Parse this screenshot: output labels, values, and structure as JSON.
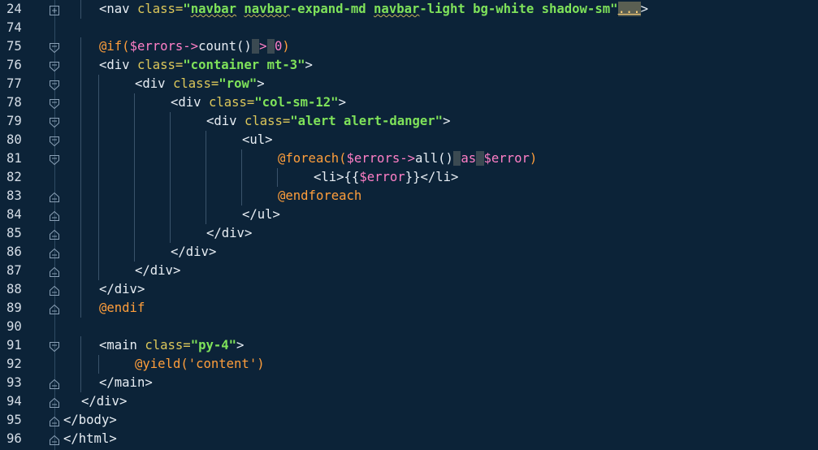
{
  "editor": {
    "theme_background": "#0c2338",
    "lines": [
      {
        "num": "24",
        "fold": "plus",
        "indent": 4,
        "tokens": [
          {
            "t": "<nav ",
            "c": "t-tag"
          },
          {
            "t": "class=",
            "c": "t-attr"
          },
          {
            "t": "\"",
            "c": "t-str"
          },
          {
            "t": "navbar",
            "c": "t-str squiggle"
          },
          {
            "t": " ",
            "c": "t-str"
          },
          {
            "t": "navbar",
            "c": "t-str squiggle"
          },
          {
            "t": "-expand-md ",
            "c": "t-str"
          },
          {
            "t": "navbar",
            "c": "t-str squiggle"
          },
          {
            "t": "-light bg-white shadow-sm\"",
            "c": "t-str"
          },
          {
            "t": "...",
            "c": "ellipsis"
          },
          {
            "t": ">",
            "c": "t-tag"
          }
        ]
      },
      {
        "num": "74",
        "fold": "none",
        "indent": 0,
        "tokens": []
      },
      {
        "num": "75",
        "fold": "open",
        "indent": 4,
        "tokens": [
          {
            "t": "@if(",
            "c": "t-dir"
          },
          {
            "t": "$errors",
            "c": "t-var"
          },
          {
            "t": "->",
            "c": "t-op"
          },
          {
            "t": "count()",
            "c": "t-func"
          },
          {
            "t": " ",
            "c": "hl-space"
          },
          {
            "t": ">",
            "c": "t-op"
          },
          {
            "t": " ",
            "c": "hl-space"
          },
          {
            "t": "0",
            "c": "t-num"
          },
          {
            "t": ")",
            "c": "t-dir"
          }
        ]
      },
      {
        "num": "76",
        "fold": "open",
        "indent": 4,
        "tokens": [
          {
            "t": "<div ",
            "c": "t-tag"
          },
          {
            "t": "class=",
            "c": "t-attr"
          },
          {
            "t": "\"container mt-3\"",
            "c": "t-str"
          },
          {
            "t": ">",
            "c": "t-tag"
          }
        ]
      },
      {
        "num": "77",
        "fold": "open",
        "indent": 8,
        "tokens": [
          {
            "t": "<div ",
            "c": "t-tag"
          },
          {
            "t": "class=",
            "c": "t-attr"
          },
          {
            "t": "\"row\"",
            "c": "t-str"
          },
          {
            "t": ">",
            "c": "t-tag"
          }
        ]
      },
      {
        "num": "78",
        "fold": "open",
        "indent": 12,
        "tokens": [
          {
            "t": "<div ",
            "c": "t-tag"
          },
          {
            "t": "class=",
            "c": "t-attr"
          },
          {
            "t": "\"col-sm-12\"",
            "c": "t-str"
          },
          {
            "t": ">",
            "c": "t-tag"
          }
        ]
      },
      {
        "num": "79",
        "fold": "open",
        "indent": 16,
        "tokens": [
          {
            "t": "<div ",
            "c": "t-tag"
          },
          {
            "t": "class=",
            "c": "t-attr"
          },
          {
            "t": "\"alert alert-danger\"",
            "c": "t-str"
          },
          {
            "t": ">",
            "c": "t-tag"
          }
        ]
      },
      {
        "num": "80",
        "fold": "open",
        "indent": 20,
        "tokens": [
          {
            "t": "<ul>",
            "c": "t-tag"
          }
        ]
      },
      {
        "num": "81",
        "fold": "open",
        "indent": 24,
        "tokens": [
          {
            "t": "@foreach(",
            "c": "t-dir"
          },
          {
            "t": "$errors",
            "c": "t-var"
          },
          {
            "t": "->",
            "c": "t-op"
          },
          {
            "t": "all()",
            "c": "t-func"
          },
          {
            "t": " ",
            "c": "hl-space"
          },
          {
            "t": "as",
            "c": "t-kw"
          },
          {
            "t": " ",
            "c": "hl-space"
          },
          {
            "t": "$error",
            "c": "t-var"
          },
          {
            "t": ")",
            "c": "t-dir"
          }
        ]
      },
      {
        "num": "82",
        "fold": "none",
        "indent": 28,
        "tokens": [
          {
            "t": "<li>{{",
            "c": "t-tag"
          },
          {
            "t": "$error",
            "c": "t-var"
          },
          {
            "t": "}}</li>",
            "c": "t-tag"
          }
        ]
      },
      {
        "num": "83",
        "fold": "close",
        "indent": 24,
        "tokens": [
          {
            "t": "@endforeach",
            "c": "t-dir"
          }
        ]
      },
      {
        "num": "84",
        "fold": "close",
        "indent": 20,
        "tokens": [
          {
            "t": "</ul>",
            "c": "t-tag"
          }
        ]
      },
      {
        "num": "85",
        "fold": "close",
        "indent": 16,
        "tokens": [
          {
            "t": "</div>",
            "c": "t-tag"
          }
        ]
      },
      {
        "num": "86",
        "fold": "close",
        "indent": 12,
        "tokens": [
          {
            "t": "</div>",
            "c": "t-tag"
          }
        ]
      },
      {
        "num": "87",
        "fold": "close",
        "indent": 8,
        "tokens": [
          {
            "t": "</div>",
            "c": "t-tag"
          }
        ]
      },
      {
        "num": "88",
        "fold": "close",
        "indent": 4,
        "tokens": [
          {
            "t": "</div>",
            "c": "t-tag"
          }
        ]
      },
      {
        "num": "89",
        "fold": "close",
        "indent": 4,
        "tokens": [
          {
            "t": "@endif",
            "c": "t-dir"
          }
        ]
      },
      {
        "num": "90",
        "fold": "none",
        "indent": 0,
        "tokens": []
      },
      {
        "num": "91",
        "fold": "open",
        "indent": 4,
        "tokens": [
          {
            "t": "<main ",
            "c": "t-tag"
          },
          {
            "t": "class=",
            "c": "t-attr"
          },
          {
            "t": "\"py-4\"",
            "c": "t-str"
          },
          {
            "t": ">",
            "c": "t-tag"
          }
        ]
      },
      {
        "num": "92",
        "fold": "none",
        "indent": 8,
        "tokens": [
          {
            "t": "@yield(",
            "c": "t-dir"
          },
          {
            "t": "'content'",
            "c": "t-pstr"
          },
          {
            "t": ")",
            "c": "t-dir"
          }
        ]
      },
      {
        "num": "93",
        "fold": "close",
        "indent": 4,
        "tokens": [
          {
            "t": "</main>",
            "c": "t-tag"
          }
        ]
      },
      {
        "num": "94",
        "fold": "close",
        "indent": 2,
        "tokens": [
          {
            "t": "</div>",
            "c": "t-tag"
          }
        ]
      },
      {
        "num": "95",
        "fold": "close",
        "indent": 0,
        "tokens": [
          {
            "t": "</body>",
            "c": "t-tag"
          }
        ]
      },
      {
        "num": "96",
        "fold": "close",
        "indent": 0,
        "tokens": [
          {
            "t": "</html>",
            "c": "t-tag"
          }
        ]
      }
    ]
  }
}
